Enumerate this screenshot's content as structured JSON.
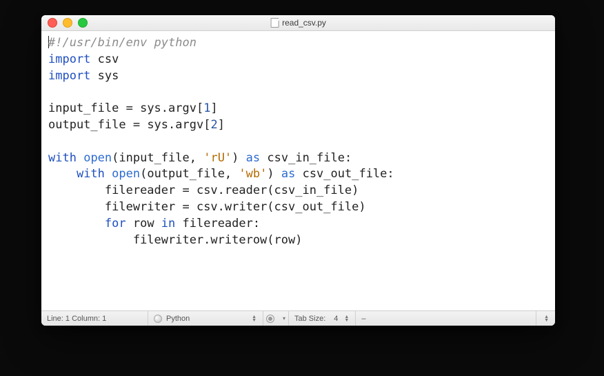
{
  "title": "read_csv.py",
  "code": {
    "line1_comment": "#!/usr/bin/env python",
    "kw_import1": "import",
    "mod_csv": "csv",
    "kw_import2": "import",
    "mod_sys": "sys",
    "input_lhs": "input_file",
    "eq": " = ",
    "sys_argv1": "sys.argv",
    "lb1": "[",
    "num1": "1",
    "rb1": "]",
    "output_lhs": "output_file",
    "sys_argv2": "sys.argv",
    "lb2": "[",
    "num2": "2",
    "rb2": "]",
    "kw_with1": "with",
    "fn_open1": "open",
    "open1_args_a": "(input_file, ",
    "str_rU": "'rU'",
    "open1_args_b": ")",
    "kw_as1": "as",
    "var_in": " csv_in_file:",
    "kw_with2": "with",
    "fn_open2": "open",
    "open2_args_a": "(output_file, ",
    "str_wb": "'wb'",
    "open2_args_b": ")",
    "kw_as2": "as",
    "var_out": " csv_out_file:",
    "fr_lhs": "filereader",
    "fr_rhs": " = csv.reader(csv_in_file)",
    "fw_lhs": "filewriter",
    "fw_rhs": " = csv.writer(csv_out_file)",
    "kw_for": "for",
    "for_mid": " row ",
    "kw_in": "in",
    "for_end": " filereader:",
    "body": "filewriter.writerow(row)"
  },
  "status": {
    "position": "Line: 1  Column: 1",
    "language": "Python",
    "tab_label": "Tab Size:",
    "tab_value": "4",
    "minus": "–"
  }
}
